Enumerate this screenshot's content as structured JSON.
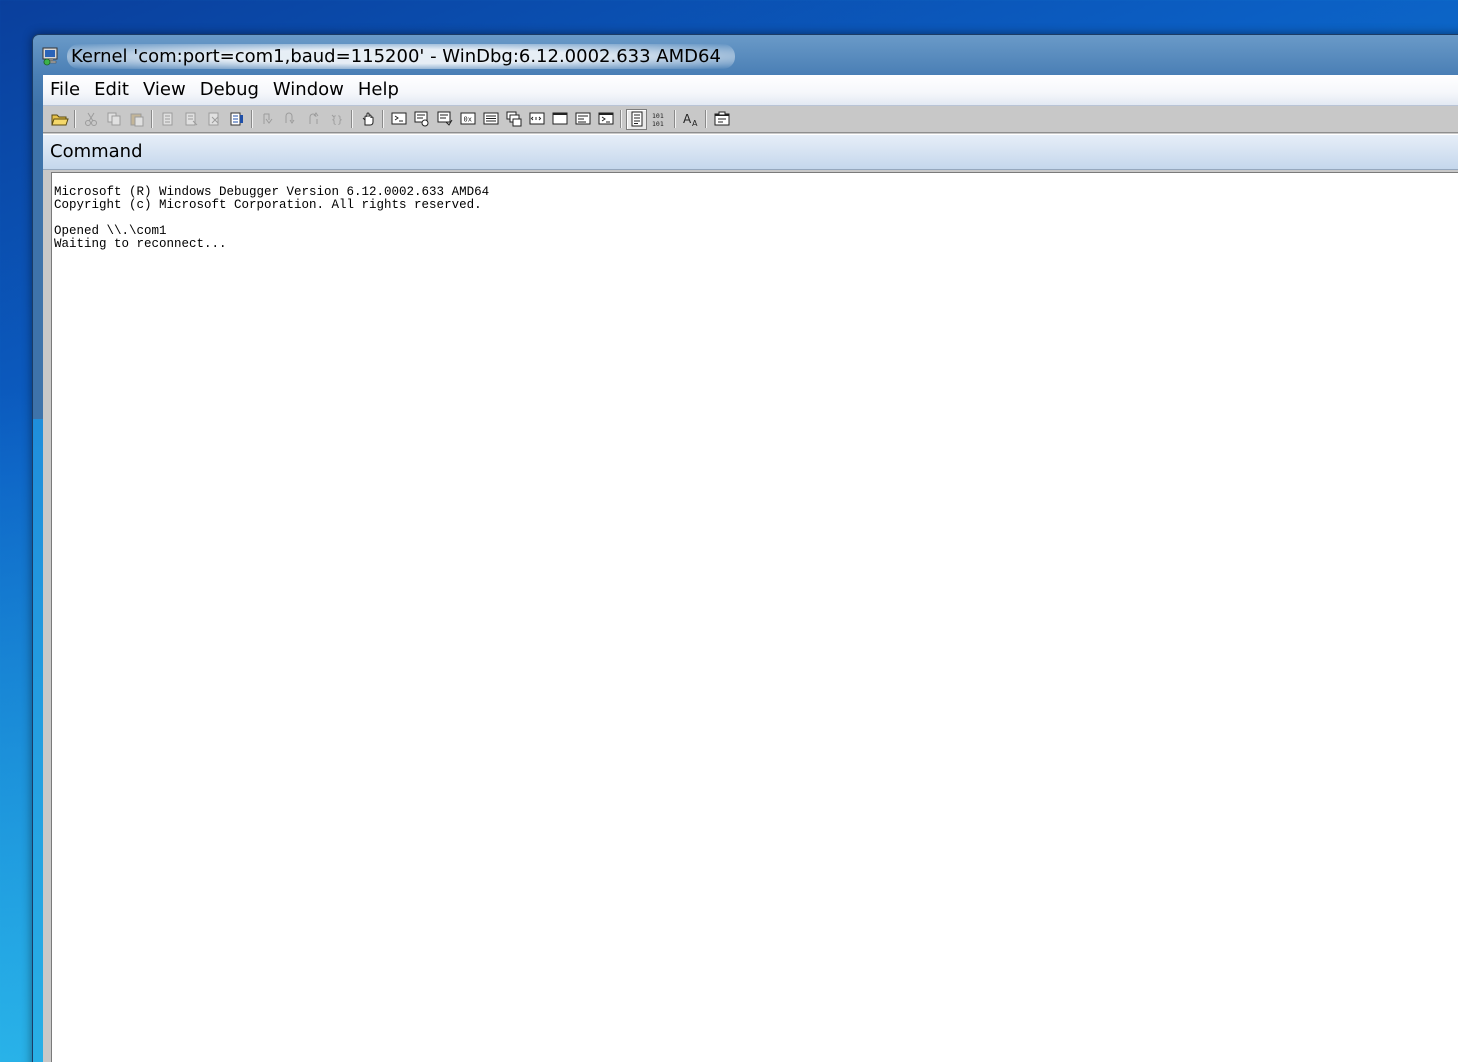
{
  "window": {
    "title": "Kernel 'com:port=com1,baud=115200' - WinDbg:6.12.0002.633 AMD64"
  },
  "menu": {
    "items": [
      {
        "label": "File"
      },
      {
        "label": "Edit"
      },
      {
        "label": "View"
      },
      {
        "label": "Debug"
      },
      {
        "label": "Window"
      },
      {
        "label": "Help"
      }
    ]
  },
  "toolbar": {
    "icons": [
      "open-folder-icon",
      "cut-icon",
      "copy-icon",
      "paste-icon",
      "go-icon",
      "restart-icon",
      "stop-debugging-icon",
      "break-icon",
      "step-into-icon",
      "step-over-icon",
      "step-out-icon",
      "run-to-cursor-icon",
      "breakpoint-hand-icon",
      "command-window-icon",
      "watch-window-icon",
      "locals-window-icon",
      "registers-window-icon",
      "memory-window-icon",
      "call-stack-icon",
      "disassembly-icon",
      "scratch-pad-icon",
      "processes-threads-icon",
      "command-browser-icon",
      "source-mode-icon",
      "hex-mode-icon",
      "font-icon",
      "options-icon"
    ]
  },
  "command_pane": {
    "title": "Command",
    "lines": [
      "Microsoft (R) Windows Debugger Version 6.12.0002.633 AMD64",
      "Copyright (c) Microsoft Corporation. All rights reserved.",
      "",
      "Opened \\\\.\\com1",
      "Waiting to reconnect..."
    ]
  }
}
